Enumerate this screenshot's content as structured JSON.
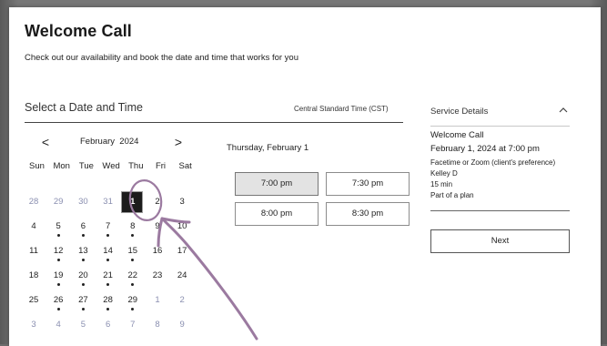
{
  "page": {
    "title": "Welcome Call",
    "subtitle": "Check out our availability and book the date and time that works for you"
  },
  "scheduler": {
    "section_title": "Select a Date and Time",
    "timezone": "Central Standard Time (CST)"
  },
  "calendar": {
    "prev_icon": "chevron-left-icon",
    "next_icon": "chevron-right-icon",
    "prev_label": "<",
    "next_label": ">",
    "month": "February",
    "year": "2024",
    "weekdays": [
      "Sun",
      "Mon",
      "Tue",
      "Wed",
      "Thu",
      "Fri",
      "Sat"
    ],
    "weeks": [
      [
        {
          "d": "28",
          "muted": true
        },
        {
          "d": "29",
          "muted": true
        },
        {
          "d": "30",
          "muted": true
        },
        {
          "d": "31",
          "muted": true
        },
        {
          "d": "1",
          "selected": true
        },
        {
          "d": "2"
        },
        {
          "d": "3"
        }
      ],
      [
        {
          "d": "4"
        },
        {
          "d": "5",
          "dot": true
        },
        {
          "d": "6",
          "dot": true
        },
        {
          "d": "7",
          "dot": true
        },
        {
          "d": "8",
          "dot": true
        },
        {
          "d": "9"
        },
        {
          "d": "10"
        }
      ],
      [
        {
          "d": "11"
        },
        {
          "d": "12",
          "dot": true
        },
        {
          "d": "13",
          "dot": true
        },
        {
          "d": "14",
          "dot": true
        },
        {
          "d": "15",
          "dot": true
        },
        {
          "d": "16"
        },
        {
          "d": "17"
        }
      ],
      [
        {
          "d": "18"
        },
        {
          "d": "19",
          "dot": true
        },
        {
          "d": "20",
          "dot": true
        },
        {
          "d": "21",
          "dot": true
        },
        {
          "d": "22",
          "dot": true
        },
        {
          "d": "23"
        },
        {
          "d": "24"
        }
      ],
      [
        {
          "d": "25"
        },
        {
          "d": "26",
          "dot": true
        },
        {
          "d": "27",
          "dot": true
        },
        {
          "d": "28",
          "dot": true
        },
        {
          "d": "29",
          "dot": true
        },
        {
          "d": "1",
          "muted": true
        },
        {
          "d": "2",
          "muted": true
        }
      ],
      [
        {
          "d": "3",
          "muted": true
        },
        {
          "d": "4",
          "muted": true
        },
        {
          "d": "5",
          "muted": true
        },
        {
          "d": "6",
          "muted": true
        },
        {
          "d": "7",
          "muted": true
        },
        {
          "d": "8",
          "muted": true
        },
        {
          "d": "9",
          "muted": true
        }
      ]
    ]
  },
  "slots": {
    "selected_date": "Thursday, February 1",
    "times": [
      "7:00 pm",
      "7:30 pm",
      "8:00 pm",
      "8:30 pm"
    ],
    "active_index": 0
  },
  "service": {
    "header": "Service Details",
    "chevron_icon": "chevron-up-icon",
    "name": "Welcome Call",
    "datetime": "February 1, 2024 at 7:00 pm",
    "location": "Facetime or Zoom (client's preference)",
    "staff": "Kelley D",
    "duration": "15 min",
    "plan": "Part of a plan",
    "next_label": "Next"
  },
  "annotation": {
    "icon": "hand-drawn-arrow-annotation",
    "color": "#9b7aa0"
  },
  "colors": {
    "selected_day_bg": "#1c1c1c",
    "active_slot_bg": "#e3e3e3",
    "muted_day": "#8a8fb0"
  }
}
